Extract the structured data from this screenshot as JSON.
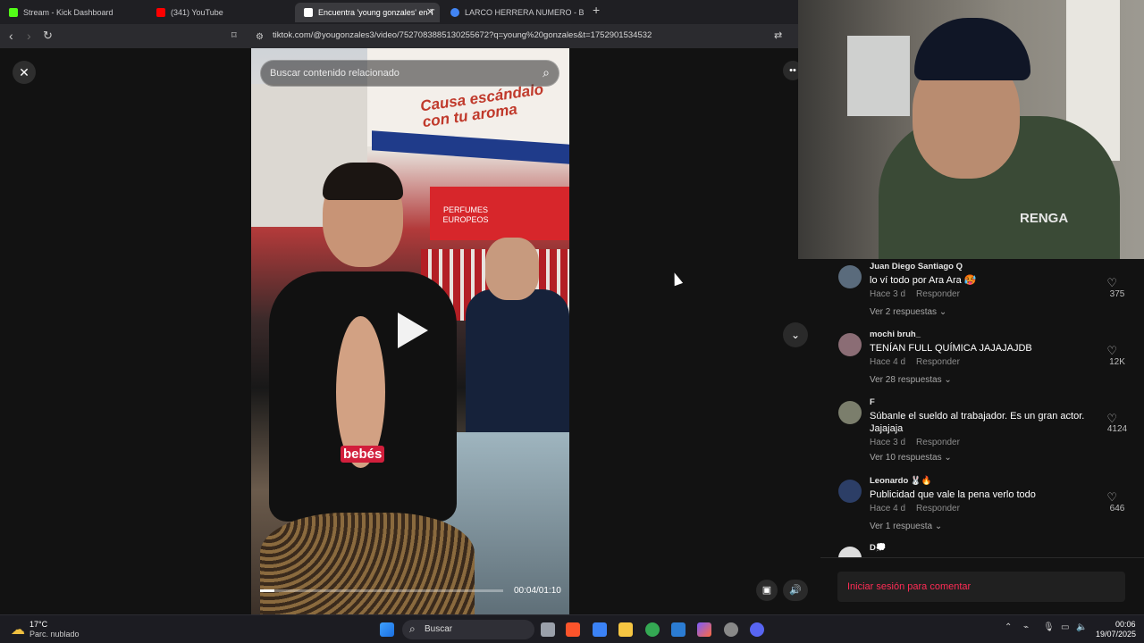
{
  "browser": {
    "tabs": [
      {
        "label": "Stream - Kick Dashboard",
        "color": "#53fc18"
      },
      {
        "label": "(341) YouTube",
        "color": "#ff0000"
      },
      {
        "label": "Encuentra 'young gonzales' en T",
        "color": "#ffffff"
      },
      {
        "label": "LARCO HERRERA NUMERO - Buscar",
        "color": "#4285f4"
      }
    ],
    "new_tab": "+",
    "url": "tiktok.com/@yougonzales3/video/7527083885130255672?q=young%20gonzales&t=1752901534532"
  },
  "player": {
    "close": "✕",
    "search_placeholder": "Buscar contenido relacionado",
    "caption": "bebés",
    "sign_text": "Causa escándalo con tu aroma",
    "store_text": "PERFUMES EUROPEOS",
    "time": "00:04/01:10",
    "progress": 0.057
  },
  "comments": [
    {
      "user": "Juan Diego Santiago Q",
      "text": "lo ví todo por Ara Ara 🥵",
      "age": "Hace 3 d",
      "reply": "Responder",
      "likes": "375",
      "replies": "Ver 2 respuestas"
    },
    {
      "user": "mochi bruh_",
      "text": "TENÍAN FULL QUÍMICA JAJAJAJDB",
      "age": "Hace 4 d",
      "reply": "Responder",
      "likes": "12K",
      "replies": "Ver 28 respuestas"
    },
    {
      "user": "F",
      "text": "Súbanle el sueldo al trabajador. Es un gran actor. Jajajaja",
      "age": "Hace 3 d",
      "reply": "Responder",
      "likes": "4124",
      "replies": "Ver 10 respuestas"
    },
    {
      "user": "Leonardo 🐰🔥",
      "text": "Publicidad que vale la pena verlo todo",
      "age": "Hace 4 d",
      "reply": "Responder",
      "likes": "646",
      "replies": "Ver 1 respuesta"
    },
    {
      "user": "D💭",
      "text": "",
      "age": "",
      "reply": "",
      "likes": "",
      "replies": ""
    }
  ],
  "login_prompt": "Iniciar sesión para comentar",
  "taskbar": {
    "weather_temp": "17°C",
    "weather_desc": "Parc. nublado",
    "search_label": "Buscar",
    "time": "00:06",
    "date": "19/07/2025"
  },
  "webcam": {
    "shirt_text": "RENGA"
  }
}
